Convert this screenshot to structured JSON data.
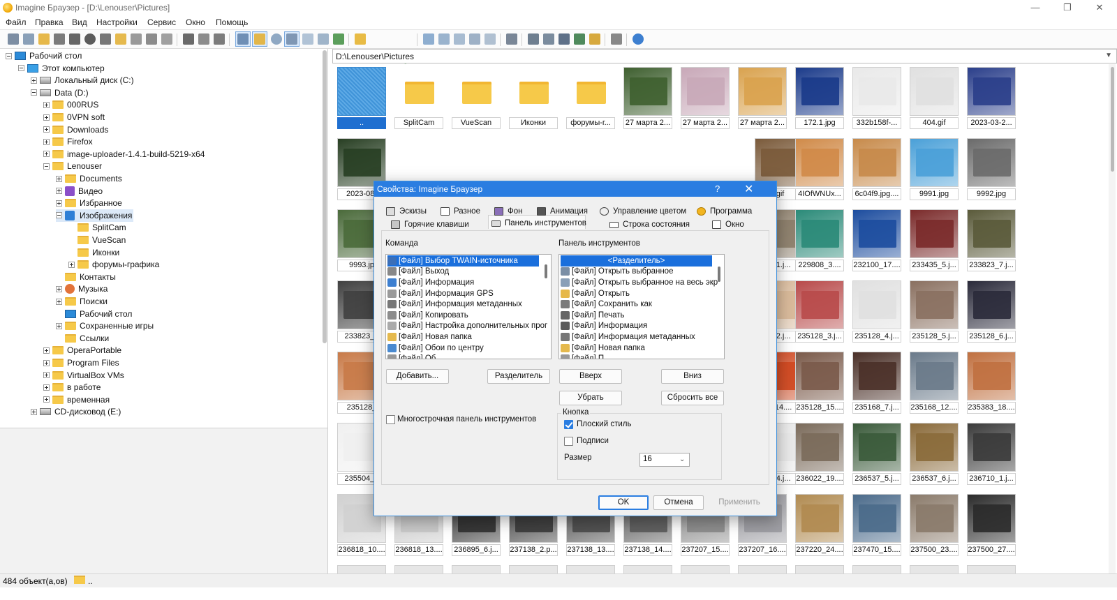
{
  "window": {
    "title": "Imagine Браузер - [D:\\Lenouser\\Pictures]",
    "minimize": "—",
    "maximize": "❐",
    "close": "✕"
  },
  "menu": [
    "Файл",
    "Правка",
    "Вид",
    "Настройки",
    "Сервис",
    "Окно",
    "Помощь"
  ],
  "tree": [
    {
      "label": "Рабочий стол",
      "level": 0,
      "icon": "desktop",
      "exp": "minus"
    },
    {
      "label": "Этот компьютер",
      "level": 1,
      "icon": "pc",
      "exp": "minus"
    },
    {
      "label": "Локальный диск (C:)",
      "level": 2,
      "icon": "drive",
      "exp": "plus"
    },
    {
      "label": "Data (D:)",
      "level": 2,
      "icon": "drive",
      "exp": "minus"
    },
    {
      "label": "000RUS",
      "level": 3,
      "icon": "folder",
      "exp": "plus"
    },
    {
      "label": "0VPN soft",
      "level": 3,
      "icon": "folder",
      "exp": "plus"
    },
    {
      "label": "Downloads",
      "level": 3,
      "icon": "folder",
      "exp": "plus"
    },
    {
      "label": "Firefox",
      "level": 3,
      "icon": "folder",
      "exp": "plus"
    },
    {
      "label": "image-uploader-1.4.1-build-5219-x64",
      "level": 3,
      "icon": "folder",
      "exp": "plus"
    },
    {
      "label": "Lenouser",
      "level": 3,
      "icon": "folder",
      "exp": "minus"
    },
    {
      "label": "Documents",
      "level": 4,
      "icon": "folder",
      "exp": "plus"
    },
    {
      "label": "Видео",
      "level": 4,
      "icon": "video",
      "exp": "plus"
    },
    {
      "label": "Избранное",
      "level": 4,
      "icon": "folder",
      "exp": "plus"
    },
    {
      "label": "Изображения",
      "level": 4,
      "icon": "images",
      "exp": "minus",
      "selected": true
    },
    {
      "label": "SplitCam",
      "level": 5,
      "icon": "folder",
      "exp": "none"
    },
    {
      "label": "VueScan",
      "level": 5,
      "icon": "folder",
      "exp": "none"
    },
    {
      "label": "Иконки",
      "level": 5,
      "icon": "folder",
      "exp": "none"
    },
    {
      "label": "форумы-графика",
      "level": 5,
      "icon": "folder",
      "exp": "plus"
    },
    {
      "label": "Контакты",
      "level": 4,
      "icon": "folder",
      "exp": "none"
    },
    {
      "label": "Музыка",
      "level": 4,
      "icon": "music",
      "exp": "plus"
    },
    {
      "label": "Поиски",
      "level": 4,
      "icon": "folder",
      "exp": "plus"
    },
    {
      "label": "Рабочий стол",
      "level": 4,
      "icon": "desktop",
      "exp": "none"
    },
    {
      "label": "Сохраненные игры",
      "level": 4,
      "icon": "folder",
      "exp": "plus"
    },
    {
      "label": "Ссылки",
      "level": 4,
      "icon": "folder",
      "exp": "none"
    },
    {
      "label": "OperaPortable",
      "level": 3,
      "icon": "folder",
      "exp": "plus"
    },
    {
      "label": "Program Files",
      "level": 3,
      "icon": "folder",
      "exp": "plus"
    },
    {
      "label": "VirtualBox VMs",
      "level": 3,
      "icon": "folder",
      "exp": "plus"
    },
    {
      "label": "в работе",
      "level": 3,
      "icon": "folder",
      "exp": "plus"
    },
    {
      "label": "временная",
      "level": 3,
      "icon": "folder",
      "exp": "plus"
    },
    {
      "label": "CD-дисковод (E:)",
      "level": 2,
      "icon": "drive",
      "exp": "plus"
    }
  ],
  "path": "D:\\Lenouser\\Pictures",
  "thumbnails": [
    [
      "..",
      "SplitCam",
      "VueScan",
      "Иконки",
      "форумы-г...",
      "27 марта 2...",
      "27 марта 2...",
      "27 марта 2...",
      "172.1.jpg",
      "332b158f-...",
      "404.gif",
      "2023-03-2..."
    ],
    [
      "2023-08-",
      "",
      "",
      "",
      "",
      "",
      "",
      "",
      ".gif",
      "4IOfWNUx...",
      "6c04f9.jpg....",
      "9991.jpg",
      "9992.jpg"
    ],
    [
      "9993.jp",
      "",
      "",
      "",
      "",
      "",
      "",
      "",
      "8_1.j...",
      "229808_3....",
      "232100_17....",
      "233435_5.j...",
      "233823_7.j..."
    ],
    [
      "233823_8",
      "",
      "",
      "",
      "",
      "",
      "",
      "",
      "8_2.j...",
      "235128_3.j...",
      "235128_4.j...",
      "235128_5.j...",
      "235128_6.j..."
    ],
    [
      "235128_",
      "",
      "",
      "",
      "",
      "",
      "",
      "",
      "8_14....",
      "235128_15....",
      "235168_7.j...",
      "235168_12....",
      "235383_18...."
    ],
    [
      "235504_8",
      "",
      "",
      "",
      "",
      "",
      "",
      "",
      "9_4.j...",
      "236022_19....",
      "236537_5.j...",
      "236537_6.j...",
      "236710_1.j..."
    ],
    [
      "236818_10....",
      "236818_13....",
      "236895_6.j...",
      "237138_2.p...",
      "237138_13....",
      "237138_14....",
      "237207_15....",
      "237207_16....",
      "237220_24....",
      "237470_15....",
      "237500_23....",
      "237500_27...."
    ]
  ],
  "status": {
    "count": "484 объект(а,ов)",
    "folder": ".."
  },
  "dialog": {
    "title": "Свойства: Imagine Браузер",
    "help": "?",
    "close": "✕",
    "tabs_row1": [
      "Эскизы",
      "Разное",
      "Фон",
      "Анимация",
      "Управление цветом",
      "Программа"
    ],
    "tabs_row2": [
      "Горячие клавиши",
      "Панель инструментов",
      "Строка состояния",
      "Окно"
    ],
    "active_tab": "Панель инструментов",
    "command_label": "Команда",
    "toolbar_label": "Панель инструментов",
    "commands": [
      "[Файл] Выбор TWAIN-источника",
      "[Файл] Выход",
      "[Файл] Информация",
      "[Файл] Информация GPS",
      "[Файл] Информация метаданных",
      "[Файл] Копировать",
      "[Файл] Настройка дополнительных прог",
      "[Файл] Новая папка",
      "[Файл] Обои по центру",
      "[Файл] Об..."
    ],
    "toolbar_items": [
      "<Разделитель>",
      "[Файл] Открыть выбранное",
      "[Файл] Открыть выбранное на весь экр",
      "[Файл] Открыть",
      "[Файл] Сохранить как",
      "[Файл] Печать",
      "[Файл] Информация",
      "[Файл] Информация метаданных",
      "[Файл] Новая папка",
      "[Файл] П..."
    ],
    "buttons": {
      "add": "Добавить...",
      "separator": "Разделитель",
      "up": "Вверх",
      "down": "Вниз",
      "remove": "Убрать",
      "reset": "Сбросить все",
      "ok": "OK",
      "cancel": "Отмена",
      "apply": "Применить"
    },
    "multiline_label": "Многострочная панель инструментов",
    "button_group_label": "Кнопка",
    "flat_style_label": "Плоский стиль",
    "captions_label": "Подписи",
    "size_label": "Размер",
    "size_value": "16",
    "multiline_checked": false,
    "flat_style_checked": true,
    "captions_checked": false
  },
  "colors": {
    "accent": "#2a7de1",
    "selection": "#1a6fdc",
    "folder": "#f6c949"
  }
}
